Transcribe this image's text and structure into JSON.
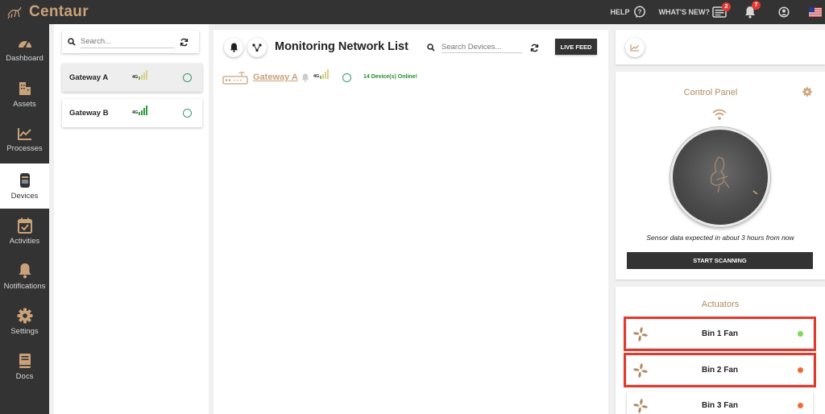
{
  "app": {
    "brand": "Centaur"
  },
  "topbar": {
    "help_label": "HELP",
    "whats_new_label": "WHAT'S NEW?",
    "whats_new_badge": "2",
    "notifications_badge": "7"
  },
  "sidebar": {
    "items": [
      {
        "label": "Dashboard",
        "icon": "speedometer-icon"
      },
      {
        "label": "Assets",
        "icon": "building-icon"
      },
      {
        "label": "Processes",
        "icon": "trend-chart-icon"
      },
      {
        "label": "Devices",
        "icon": "device-icon",
        "active": true
      },
      {
        "label": "Activities",
        "icon": "calendar-check-icon"
      },
      {
        "label": "Notifications",
        "icon": "bell-icon"
      },
      {
        "label": "Settings",
        "icon": "gear-icon"
      },
      {
        "label": "Docs",
        "icon": "book-icon"
      }
    ]
  },
  "gateways": {
    "search_placeholder": "Search...",
    "items": [
      {
        "name": "Gateway A",
        "network": "4G",
        "selected": true
      },
      {
        "name": "Gateway B",
        "network": "4G",
        "selected": false
      }
    ]
  },
  "main": {
    "title": "Monitoring Network List",
    "search_placeholder": "Search Devices...",
    "live_feed_label": "LIVE FEED",
    "gateway_link": "Gateway A",
    "gateway_network": "4G",
    "online_status": "14 Device(s) Online!"
  },
  "control_panel": {
    "title": "Control Panel",
    "sensor_text": "Sensor data expected in about 3 hours from now",
    "scan_button": "START SCANNING"
  },
  "actuators": {
    "title": "Actuators",
    "items": [
      {
        "name": "Bin 1 Fan",
        "status_color": "#7ed957",
        "highlighted": true
      },
      {
        "name": "Bin 2 Fan",
        "status_color": "#f06a35",
        "highlighted": true
      },
      {
        "name": "Bin 3 Fan",
        "status_color": "#f06a35",
        "highlighted": false
      }
    ]
  },
  "colors": {
    "accent": "#c9a27a",
    "dark": "#333333",
    "highlight_border": "#e03a2f"
  }
}
